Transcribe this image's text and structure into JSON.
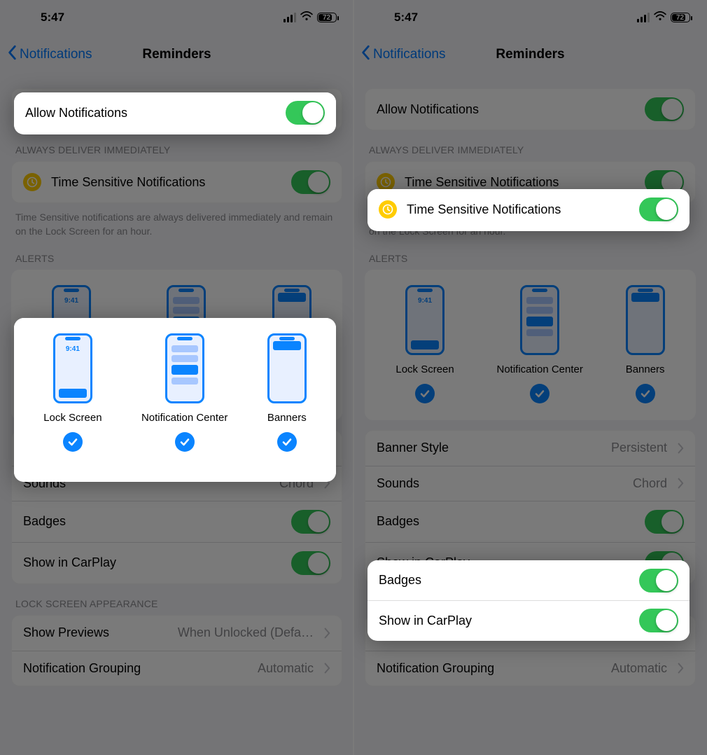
{
  "status": {
    "time": "5:47",
    "battery": "72"
  },
  "nav": {
    "back_label": "Notifications",
    "title": "Reminders"
  },
  "allow": {
    "label": "Allow Notifications",
    "on": true
  },
  "ts_header": "ALWAYS DELIVER IMMEDIATELY",
  "ts": {
    "label": "Time Sensitive Notifications",
    "on": true
  },
  "ts_footer": "Time Sensitive notifications are always delivered immediately and remain on the Lock Screen for an hour.",
  "alerts_header": "ALERTS",
  "alerts": {
    "lockscreen_time": "9:41",
    "options": [
      {
        "label": "Lock Screen",
        "checked": true
      },
      {
        "label": "Notification Center",
        "checked": true
      },
      {
        "label": "Banners",
        "checked": true
      }
    ]
  },
  "rows": {
    "banner_style": {
      "label": "Banner Style",
      "value": "Persistent"
    },
    "sounds": {
      "label": "Sounds",
      "value": "Chord"
    },
    "badges": {
      "label": "Badges",
      "on": true
    },
    "carplay": {
      "label": "Show in CarPlay",
      "on": true
    }
  },
  "ls_header": "LOCK SCREEN APPEARANCE",
  "ls_rows": {
    "show_previews": {
      "label": "Show Previews",
      "value": "When Unlocked (Defa…"
    },
    "grouping": {
      "label": "Notification Grouping",
      "value": "Automatic"
    }
  }
}
